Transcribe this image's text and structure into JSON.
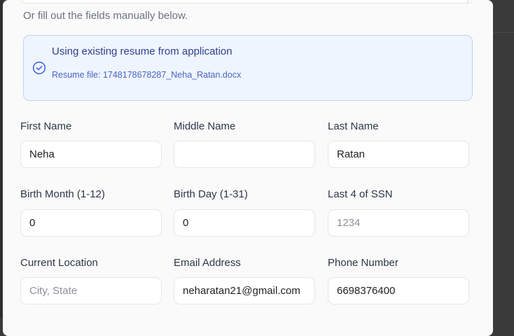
{
  "form": {
    "hint": "Or fill out the fields manually below.",
    "resume_notice": {
      "title": "Using existing resume from application",
      "file_text": "Resume file: 1748178678287_Neha_Ratan.docx"
    },
    "fields": {
      "first_name": {
        "label": "First Name",
        "value": "Neha",
        "placeholder": ""
      },
      "middle_name": {
        "label": "Middle Name",
        "value": "",
        "placeholder": ""
      },
      "last_name": {
        "label": "Last Name",
        "value": "Ratan",
        "placeholder": ""
      },
      "birth_month": {
        "label": "Birth Month (1-12)",
        "value": "0",
        "placeholder": ""
      },
      "birth_day": {
        "label": "Birth Day (1-31)",
        "value": "0",
        "placeholder": ""
      },
      "ssn_last4": {
        "label": "Last 4 of SSN",
        "value": "",
        "placeholder": "1234"
      },
      "current_location": {
        "label": "Current Location",
        "value": "",
        "placeholder": "City, State"
      },
      "email": {
        "label": "Email Address",
        "value": "neharatan21@gmail.com",
        "placeholder": ""
      },
      "phone": {
        "label": "Phone Number",
        "value": "6698376400",
        "placeholder": ""
      }
    }
  },
  "colors": {
    "info_bg": "#eef5ff",
    "info_border": "#bcd4f5",
    "info_text": "#2f3f8f",
    "icon": "#3b5bd6"
  },
  "icons": {
    "resume_status": "check-circle-icon"
  }
}
